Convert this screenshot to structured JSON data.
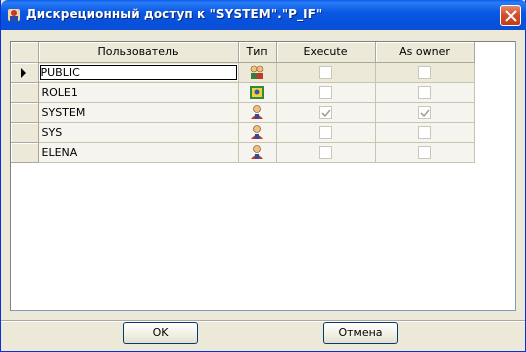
{
  "window": {
    "title": "Дискреционный доступ к \"SYSTEM\".\"P_IF\""
  },
  "grid": {
    "columns": {
      "user": "Пользователь",
      "type": "Тип",
      "execute": "Execute",
      "as_owner": "As owner"
    },
    "rows": [
      {
        "user": "PUBLIC",
        "type_icon": "users-group-icon",
        "execute": false,
        "as_owner": false,
        "selected": true
      },
      {
        "user": "ROLE1",
        "type_icon": "role-icon",
        "execute": false,
        "as_owner": false,
        "selected": false
      },
      {
        "user": "SYSTEM",
        "type_icon": "user-icon",
        "execute": true,
        "as_owner": true,
        "selected": false
      },
      {
        "user": "SYS",
        "type_icon": "user-icon",
        "execute": false,
        "as_owner": false,
        "selected": false
      },
      {
        "user": "ELENA",
        "type_icon": "user-icon",
        "execute": false,
        "as_owner": false,
        "selected": false
      }
    ]
  },
  "buttons": {
    "ok": "OK",
    "cancel": "Отмена"
  }
}
